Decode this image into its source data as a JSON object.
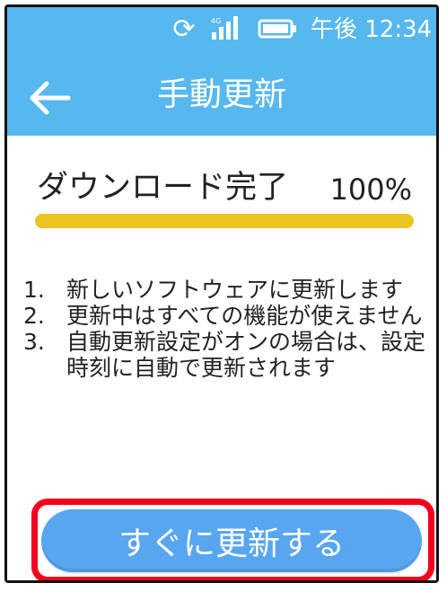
{
  "status_bar": {
    "sync_icon": "sync-icon",
    "signal_icon": "signal-icon",
    "signal_label": "4G",
    "battery_icon": "battery-icon",
    "time": "午後 12:34"
  },
  "header": {
    "back_icon": "back-arrow-icon",
    "title": "手動更新",
    "color": "#56b8ee"
  },
  "download": {
    "label": "ダウンロード完了",
    "percent_text": "100%",
    "progress": 1.0,
    "bar_color": "#ecc41e"
  },
  "notes": [
    {
      "num": "1.",
      "text": "新しいソフトウェアに更新します"
    },
    {
      "num": "2.",
      "text": "更新中はすべての機能が使えません"
    },
    {
      "num": "3.",
      "text": "自動更新設定がオンの場合は、設定時刻に自動で更新されます"
    }
  ],
  "action": {
    "update_now_label": "すぐに更新する",
    "button_color": "#58a6ef",
    "highlight_color": "#f2001d"
  }
}
